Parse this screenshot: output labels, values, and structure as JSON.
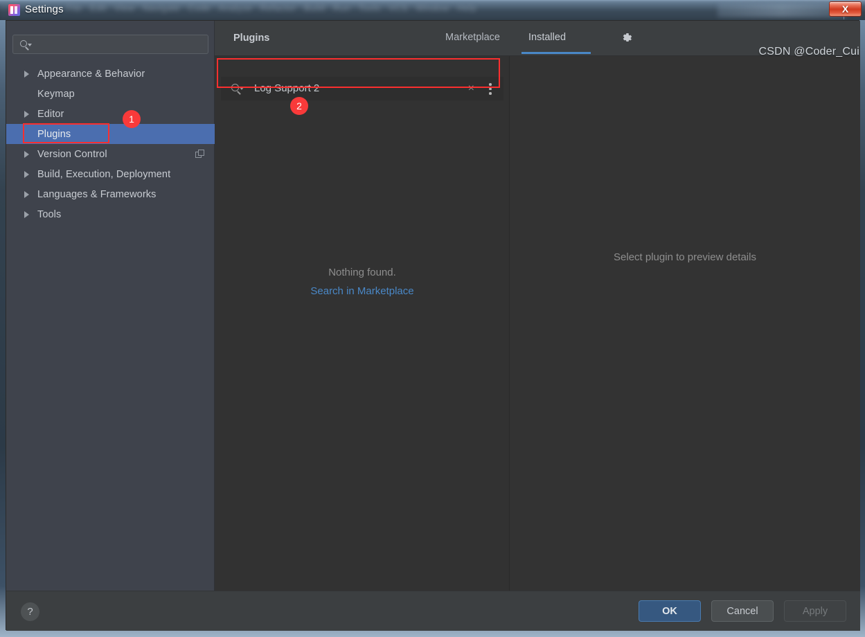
{
  "window": {
    "title": "Settings",
    "app_icon": "intellij-idea-icon",
    "close_label": "X"
  },
  "sidebar": {
    "search": {
      "value": "",
      "placeholder": "",
      "icon": "search-icon"
    },
    "items": [
      {
        "label": "Appearance & Behavior",
        "expandable": true,
        "selected": false
      },
      {
        "label": "Keymap",
        "expandable": false,
        "selected": false
      },
      {
        "label": "Editor",
        "expandable": true,
        "selected": false
      },
      {
        "label": "Plugins",
        "expandable": false,
        "selected": true
      },
      {
        "label": "Version Control",
        "expandable": true,
        "selected": false,
        "trailing_icon": "copy-icon"
      },
      {
        "label": "Build, Execution, Deployment",
        "expandable": true,
        "selected": false
      },
      {
        "label": "Languages & Frameworks",
        "expandable": true,
        "selected": false
      },
      {
        "label": "Tools",
        "expandable": true,
        "selected": false
      }
    ]
  },
  "header": {
    "title": "Plugins",
    "tabs": [
      {
        "label": "Marketplace",
        "active": false
      },
      {
        "label": "Installed",
        "active": true
      }
    ],
    "settings_icon": "gear-icon"
  },
  "plugins_panel": {
    "search": {
      "value": "Log Support 2",
      "placeholder": "",
      "icon": "search-icon",
      "clear_label": "×",
      "menu_icon": "more-vertical-icon"
    },
    "empty_state": {
      "message": "Nothing found.",
      "link": "Search in Marketplace"
    }
  },
  "preview": {
    "placeholder": "Select plugin to preview details"
  },
  "footer": {
    "help_label": "?",
    "ok_label": "OK",
    "cancel_label": "Cancel",
    "apply_label": "Apply"
  },
  "annotations": {
    "badge_1": "1",
    "badge_2": "2",
    "color": "#fc2f2f"
  },
  "watermark": "CSDN @Coder_Cui",
  "colors": {
    "accent_blue": "#4a88c7",
    "selection_blue": "#4b6eaf",
    "sidebar_bg": "#3f434c",
    "panel_bg": "#323232",
    "dialog_bg": "#3c3f41",
    "annotation_red": "#fc2f2f",
    "ok_button": "#365880"
  }
}
